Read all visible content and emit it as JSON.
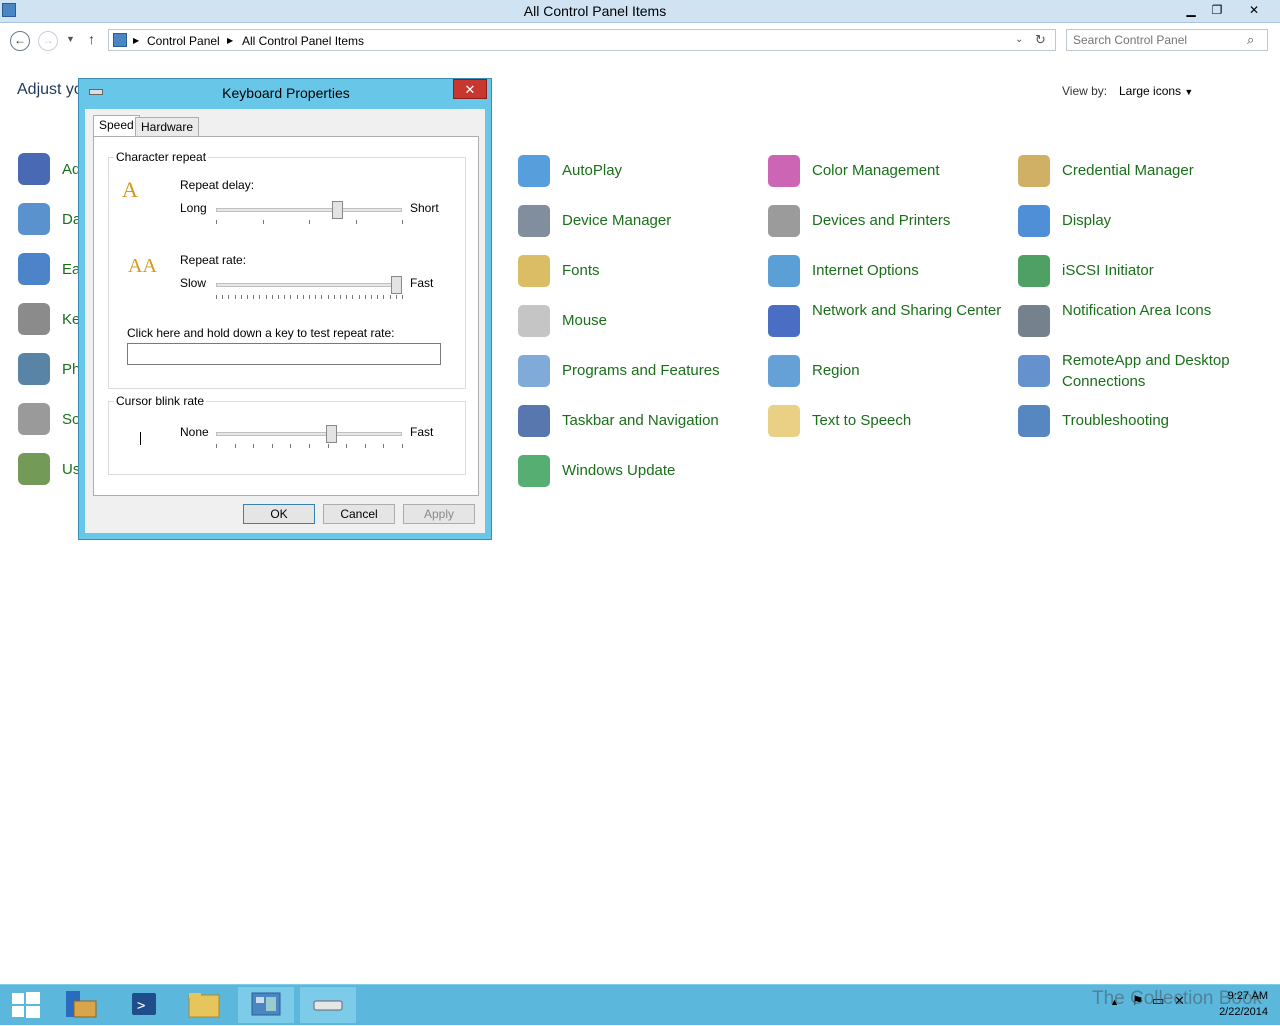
{
  "window": {
    "title": "All Control Panel Items",
    "minimize": "▁",
    "restore": "❐",
    "close": "✕"
  },
  "breadcrumb": {
    "items": [
      "Control Panel",
      "All Control Panel Items"
    ]
  },
  "search": {
    "placeholder": "Search Control Panel"
  },
  "content": {
    "heading": "Adjust yo",
    "view_by_label": "View by:",
    "view_by_value": "Large icons",
    "left_column_labels": [
      "Ad",
      "Da",
      "Ea",
      "Ke",
      "Ph",
      "So",
      "Us"
    ],
    "items": [
      {
        "label": "AutoPlay",
        "icon": "autoplay-icon"
      },
      {
        "label": "Color Management",
        "icon": "color-management-icon"
      },
      {
        "label": "Credential Manager",
        "icon": "credential-manager-icon"
      },
      {
        "label": "Device Manager",
        "icon": "device-manager-icon"
      },
      {
        "label": "Devices and Printers",
        "icon": "devices-printers-icon"
      },
      {
        "label": "Display",
        "icon": "display-icon"
      },
      {
        "label": "Fonts",
        "icon": "fonts-icon"
      },
      {
        "label": "Internet Options",
        "icon": "internet-options-icon"
      },
      {
        "label": "iSCSI Initiator",
        "icon": "iscsi-icon"
      },
      {
        "label": "Mouse",
        "icon": "mouse-icon"
      },
      {
        "label": "Network and Sharing Center",
        "icon": "network-icon"
      },
      {
        "label": "Notification Area Icons",
        "icon": "notification-icon"
      },
      {
        "label": "Programs and Features",
        "icon": "programs-icon"
      },
      {
        "label": "Region",
        "icon": "region-icon"
      },
      {
        "label": "RemoteApp and Desktop Connections",
        "icon": "remoteapp-icon"
      },
      {
        "label": "Taskbar and Navigation",
        "icon": "taskbar-icon"
      },
      {
        "label": "Text to Speech",
        "icon": "text-to-speech-icon"
      },
      {
        "label": "Troubleshooting",
        "icon": "troubleshooting-icon"
      },
      {
        "label": "Windows Update",
        "icon": "windows-update-icon"
      }
    ]
  },
  "dialog": {
    "title": "Keyboard Properties",
    "close": "✕",
    "tabs": [
      "Speed",
      "Hardware"
    ],
    "char_repeat": {
      "group_label": "Character repeat",
      "delay_label": "Repeat delay:",
      "delay_min": "Long",
      "delay_max": "Short",
      "delay_level": 0.65,
      "rate_label": "Repeat rate:",
      "rate_min": "Slow",
      "rate_max": "Fast",
      "rate_level": 0.97,
      "test_label": "Click here and hold down a key to test repeat rate:",
      "test_value": ""
    },
    "cursor_blink": {
      "group_label": "Cursor blink rate",
      "min": "None",
      "max": "Fast",
      "level": 0.62
    },
    "buttons": {
      "ok": "OK",
      "cancel": "Cancel",
      "apply": "Apply"
    }
  },
  "taskbar": {
    "time": "9:27 AM",
    "date": "2/22/2014",
    "watermark": "The Collection Book"
  }
}
